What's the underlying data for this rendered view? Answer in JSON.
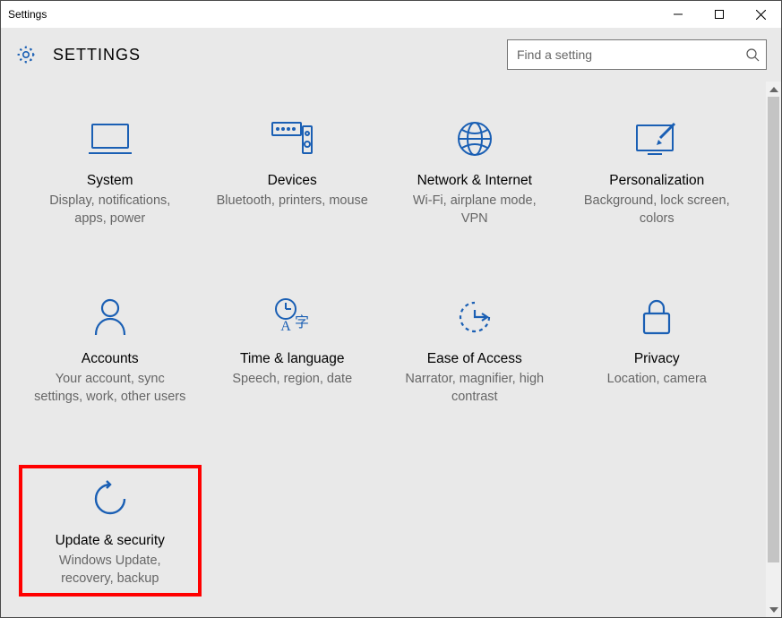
{
  "window": {
    "title": "Settings"
  },
  "header": {
    "title": "SETTINGS"
  },
  "search": {
    "placeholder": "Find a setting"
  },
  "tiles": [
    {
      "id": "system",
      "title": "System",
      "desc": "Display, notifications, apps, power"
    },
    {
      "id": "devices",
      "title": "Devices",
      "desc": "Bluetooth, printers, mouse"
    },
    {
      "id": "network",
      "title": "Network & Internet",
      "desc": "Wi-Fi, airplane mode, VPN"
    },
    {
      "id": "personalization",
      "title": "Personalization",
      "desc": "Background, lock screen, colors"
    },
    {
      "id": "accounts",
      "title": "Accounts",
      "desc": "Your account, sync settings, work, other users"
    },
    {
      "id": "time-language",
      "title": "Time & language",
      "desc": "Speech, region, date"
    },
    {
      "id": "ease-of-access",
      "title": "Ease of Access",
      "desc": "Narrator, magnifier, high contrast"
    },
    {
      "id": "privacy",
      "title": "Privacy",
      "desc": "Location, camera"
    },
    {
      "id": "update-security",
      "title": "Update & security",
      "desc": "Windows Update, recovery, backup",
      "highlight": true
    }
  ],
  "colors": {
    "accent": "#1a5fb4",
    "highlight": "#ff0000"
  }
}
